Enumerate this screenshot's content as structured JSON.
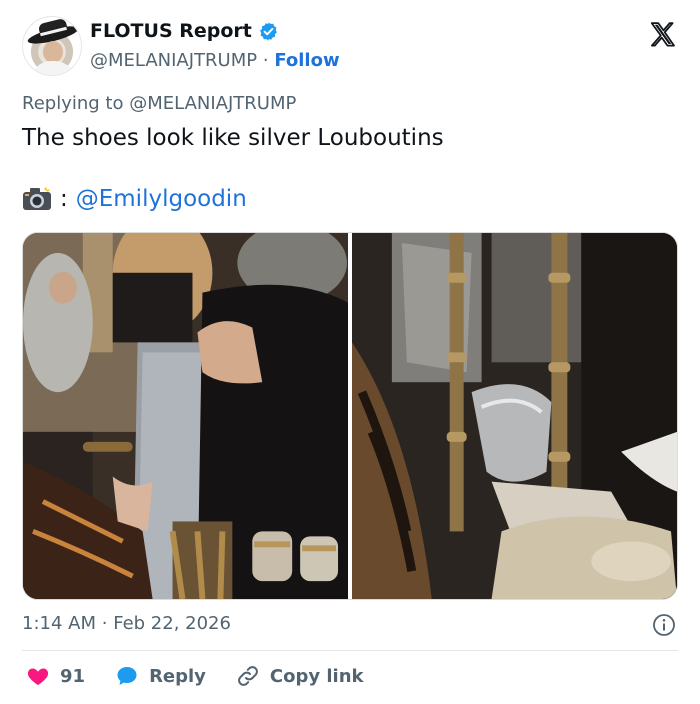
{
  "colors": {
    "link": "#1d73d9",
    "muted": "#536471",
    "like": "#f91880",
    "verified": "#1d9bf0"
  },
  "header": {
    "name": "FLOTUS Report",
    "handle": "@MELANIAJTRUMP",
    "separator": "·",
    "follow_label": "Follow"
  },
  "tweet": {
    "replying_prefix": "Replying to",
    "replying_handle": "@MELANIAJTRUMP",
    "text": "The shoes look like silver Louboutins",
    "credit_icon": "camera-icon",
    "credit_sep": ":",
    "credit_handle": "@Emilylgoodin"
  },
  "media": {
    "photos": [
      {
        "name": "photo-left",
        "subject": "guests at a dinner in a sequined skirt"
      },
      {
        "name": "photo-right",
        "subject": "close-up of silver shoe by gold chair"
      }
    ]
  },
  "meta": {
    "time": "1:14 AM",
    "separator": "·",
    "date": "Feb 22, 2026"
  },
  "actions": {
    "likes": "91",
    "reply_label": "Reply",
    "copy_label": "Copy link"
  }
}
